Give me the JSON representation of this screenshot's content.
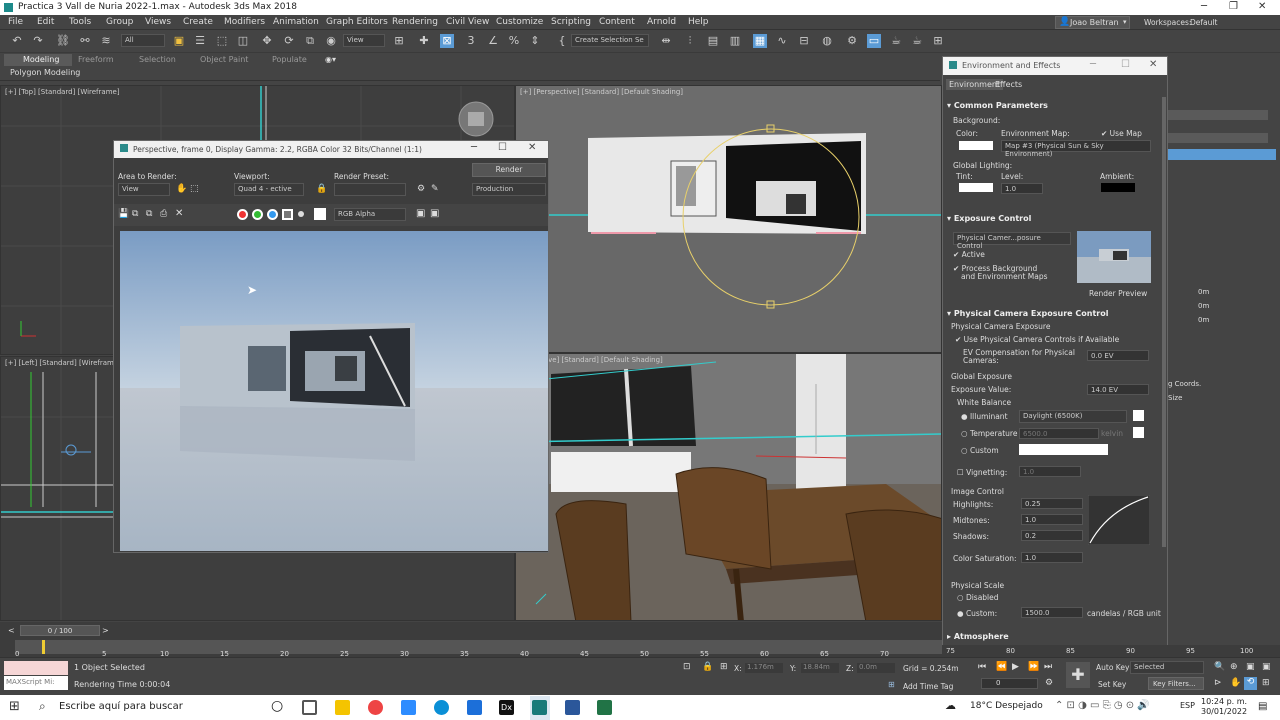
{
  "window": {
    "title": "Practica 3 Vall de Nuria 2022-1.max - Autodesk 3ds Max 2018"
  },
  "menu": {
    "items": [
      "File",
      "Edit",
      "Tools",
      "Group",
      "Views",
      "Create",
      "Modifiers",
      "Animation",
      "Graph Editors",
      "Rendering",
      "Civil View",
      "Customize",
      "Scripting",
      "Content",
      "Arnold",
      "Help"
    ],
    "user": "Joao Beltran",
    "workspaces_label": "Workspaces:",
    "workspace": "Default"
  },
  "toolbar": {
    "filter": "All",
    "refcoord": "View",
    "selection_set": "Create Selection Se"
  },
  "ribbon": {
    "tabs": [
      "Modeling",
      "Freeform",
      "Selection",
      "Object Paint",
      "Populate"
    ],
    "sub": "Polygon Modeling"
  },
  "viewports": {
    "top": "[+] [Top] [Standard] [Wireframe]",
    "left": "[+] [Left] [Standard] [Wirefram",
    "perspective": "[+] [Perspective] [Standard] [Default Shading]",
    "camera": "erspective] [Standard] [Default Shading]"
  },
  "render_window": {
    "title": "Perspective, frame 0, Display Gamma: 2.2, RGBA Color 32 Bits/Channel (1:1)",
    "area_label": "Area to Render:",
    "area_value": "View",
    "viewport_label": "Viewport:",
    "viewport_value": "Quad 4 - ective",
    "preset_label": "Render Preset:",
    "preset_value": "",
    "render_btn": "Render",
    "mode": "Production",
    "channel": "RGB Alpha"
  },
  "env": {
    "title": "Environment and Effects",
    "tabs": [
      "Environment",
      "Effects"
    ],
    "common": "Common Parameters",
    "background": "Background:",
    "color": "Color:",
    "env_map": "Environment Map:",
    "use_map": "Use Map",
    "map_name": "Map #3 (Physical Sun & Sky Environment)",
    "global_lighting": "Global Lighting:",
    "tint": "Tint:",
    "level": "Level:",
    "level_value": "1.0",
    "ambient": "Ambient:",
    "exposure_control": "Exposure Control",
    "exposure_type": "Physical Camer...posure Control",
    "active": "Active",
    "process_bg": "Process Background",
    "and_env": "and Environment Maps",
    "render_preview": "Render Preview",
    "pce_title": "Physical Camera Exposure Control",
    "pce_sub": "Physical Camera Exposure",
    "use_phys": "Use Physical Camera Controls if Available",
    "ev_comp": "EV Compensation for Physical",
    "cameras": "Cameras:",
    "ev_comp_value": "0.0 EV",
    "global_exposure": "Global Exposure",
    "exposure_value_label": "Exposure Value:",
    "exposure_value": "14.0 EV",
    "white_balance": "White Balance",
    "illuminant": "Illuminant",
    "illuminant_value": "Daylight (6500K)",
    "temperature": "Temperature",
    "temperature_value": "6500.0",
    "kelvin": "kelvin",
    "custom": "Custom",
    "vignetting": "Vignetting:",
    "vignetting_value": "1.0",
    "image_control": "Image Control",
    "highlights": "Highlights:",
    "highlights_value": "0.25",
    "midtones": "Midtones:",
    "midtones_value": "1.0",
    "shadows": "Shadows:",
    "shadows_value": "0.2",
    "saturation": "Color Saturation:",
    "saturation_value": "1.0",
    "physical_scale": "Physical Scale",
    "disabled": "Disabled",
    "custom_scale": "Custom:",
    "custom_scale_value": "1500.0",
    "units": "candelas / RGB unit",
    "atmosphere": "Atmosphere"
  },
  "right_strip": {
    "v1": "0m",
    "v2": "0m",
    "v3": "0m",
    "coords": "g Coords.",
    "size": "Size"
  },
  "timeline": {
    "frame": "0 / 100",
    "ticks": [
      "0",
      "5",
      "10",
      "15",
      "20",
      "25",
      "30",
      "35",
      "40",
      "45",
      "50",
      "55",
      "60",
      "65",
      "70",
      "75",
      "80",
      "85",
      "90",
      "95",
      "100"
    ]
  },
  "status": {
    "maxscript": "MAXScript Mi:",
    "selected": "1 Object Selected",
    "render_time": "Rendering Time 0:00:04",
    "x_label": "X:",
    "x_value": "1.176m",
    "y_label": "Y:",
    "y_value": "18.84m",
    "z_label": "Z:",
    "z_value": "0.0m",
    "grid": "Grid = 0.254m",
    "add_time_tag": "Add Time Tag",
    "auto_key": "Auto Key",
    "selected_dd": "Selected",
    "set_key": "Set Key",
    "key_filters": "Key Filters...",
    "frame_field": "0"
  },
  "taskbar": {
    "search": "Escribe aquí para buscar",
    "weather": "18°C  Despejado",
    "lang": "ESP",
    "time": "10:24 p. m.",
    "date": "30/01/2022"
  },
  "colors": {
    "accent": "#5b9bd5",
    "ui_bg": "#444444"
  }
}
